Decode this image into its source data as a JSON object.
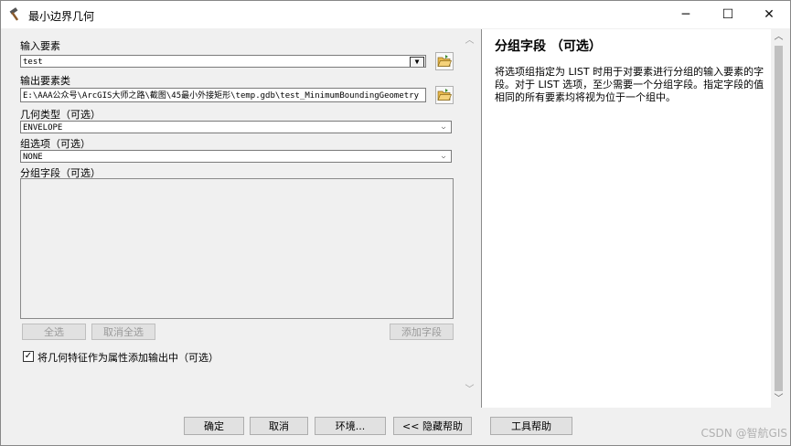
{
  "window": {
    "title": "最小边界几何",
    "minimize": "─",
    "maximize": "☐",
    "close": "✕"
  },
  "form": {
    "input_label": "输入要素",
    "input_value": "test",
    "output_label": "输出要素类",
    "output_value": "E:\\AAA公众号\\ArcGIS大师之路\\截图\\45最小外接矩形\\temp.gdb\\test_MinimumBoundingGeometry",
    "geom_label": "几何类型（可选）",
    "geom_value": "ENVELOPE",
    "group_option_label": "组选项（可选）",
    "group_option_value": "NONE",
    "group_field_label": "分组字段（可选）",
    "select_all": "全选",
    "deselect_all": "取消全选",
    "add_field": "添加字段",
    "checkbox_checked": true,
    "checkbox_label": "将几何特征作为属性添加输出中（可选）"
  },
  "help": {
    "title": "分组字段 （可选）",
    "body": "将选项组指定为 LIST 时用于对要素进行分组的输入要素的字段。对于 LIST 选项，至少需要一个分组字段。指定字段的值相同的所有要素均将视为位于一个组中。"
  },
  "buttons": {
    "ok": "确定",
    "cancel": "取消",
    "env": "环境...",
    "hide_help": "<< 隐藏帮助",
    "tool_help": "工具帮助"
  },
  "watermark": "CSDN @智航GIS"
}
